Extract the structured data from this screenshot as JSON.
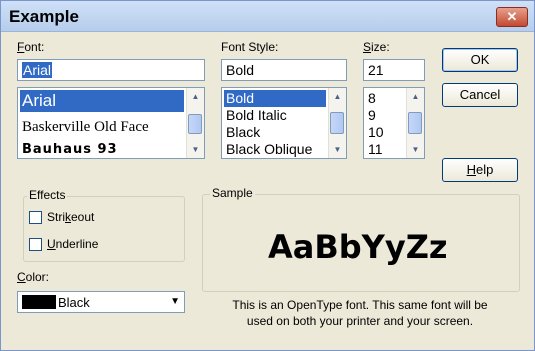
{
  "window": {
    "title": "Example",
    "close_label": "✕"
  },
  "font": {
    "label_prefix": "",
    "label_accel": "F",
    "label_rest": "ont:",
    "input_value": "Arial",
    "items": [
      {
        "text": "Arial",
        "selected": true
      },
      {
        "text": "Baskerville Old Face",
        "selected": false
      },
      {
        "text": "Bauhaus 93",
        "selected": false
      }
    ]
  },
  "style": {
    "label": "Font Style:",
    "input_value": "Bold",
    "items": [
      {
        "text": "Bold",
        "selected": true
      },
      {
        "text": "Bold Italic",
        "selected": false
      },
      {
        "text": "Black",
        "selected": false
      },
      {
        "text": "Black Oblique",
        "selected": false
      }
    ]
  },
  "size": {
    "label_prefix": "",
    "label_accel": "S",
    "label_rest": "ize:",
    "input_value": "21",
    "items": [
      {
        "text": "8",
        "selected": false
      },
      {
        "text": "9",
        "selected": false
      },
      {
        "text": "10",
        "selected": false
      },
      {
        "text": "11",
        "selected": false
      }
    ]
  },
  "buttons": {
    "ok": "OK",
    "cancel": "Cancel",
    "help_accel": "H",
    "help_rest": "elp"
  },
  "effects": {
    "title": "Effects",
    "strikeout_pre": "Stri",
    "strikeout_accel": "k",
    "strikeout_post": "eout",
    "underline_pre": "",
    "underline_accel": "U",
    "underline_post": "nderline"
  },
  "color": {
    "label_accel": "C",
    "label_rest": "olor:",
    "value": "Black",
    "swatch": "#000000"
  },
  "sample": {
    "title": "Sample",
    "text": "AaBbYyZz",
    "description_line1": "This is an OpenType font. This same font will be",
    "description_line2": "used on both your printer and your screen."
  }
}
